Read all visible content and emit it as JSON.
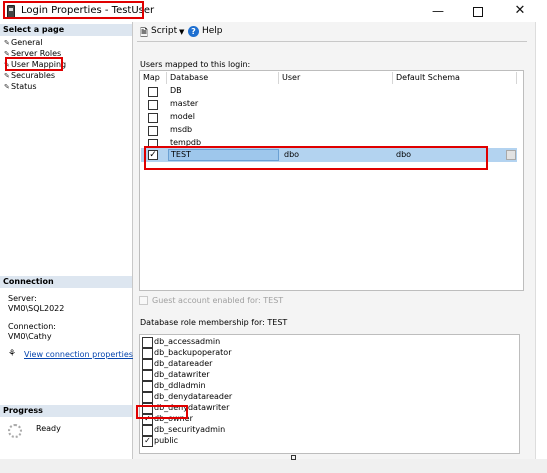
{
  "window": {
    "title": "Login Properties - TestUser"
  },
  "left": {
    "select_page_header": "Select a page",
    "pages": [
      "General",
      "Server Roles",
      "User Mapping",
      "Securables",
      "Status"
    ],
    "connection_header": "Connection",
    "server_label": "Server:",
    "server_value": "VM0\\SQL2022",
    "connection_label": "Connection:",
    "connection_value": "VM0\\Cathy",
    "view_connection_link": "View connection properties",
    "progress_header": "Progress",
    "progress_status": "Ready"
  },
  "toolbar": {
    "script_label": "Script",
    "help_label": "Help"
  },
  "mapping": {
    "section_label": "Users mapped to this login:",
    "columns": [
      "Map",
      "Database",
      "User",
      "Default Schema"
    ],
    "rows": [
      {
        "map": false,
        "database": "DB",
        "user": "",
        "schema": ""
      },
      {
        "map": false,
        "database": "master",
        "user": "",
        "schema": ""
      },
      {
        "map": false,
        "database": "model",
        "user": "",
        "schema": ""
      },
      {
        "map": false,
        "database": "msdb",
        "user": "",
        "schema": ""
      },
      {
        "map": false,
        "database": "tempdb",
        "user": "",
        "schema": ""
      },
      {
        "map": true,
        "database": "TEST",
        "user": "dbo",
        "schema": "dbo"
      }
    ]
  },
  "guest": {
    "label": "Guest account enabled for: TEST",
    "enabled": false
  },
  "roles": {
    "section_label": "Database role membership for: TEST",
    "items": [
      {
        "name": "db_accessadmin",
        "checked": false
      },
      {
        "name": "db_backupoperator",
        "checked": false
      },
      {
        "name": "db_datareader",
        "checked": false
      },
      {
        "name": "db_datawriter",
        "checked": false
      },
      {
        "name": "db_ddladmin",
        "checked": false
      },
      {
        "name": "db_denydatareader",
        "checked": false
      },
      {
        "name": "db_denydatawriter",
        "checked": false
      },
      {
        "name": "db_owner",
        "checked": true
      },
      {
        "name": "db_securityadmin",
        "checked": false
      },
      {
        "name": "public",
        "checked": true
      }
    ]
  },
  "colors": {
    "highlight_box": "#e00000",
    "selected_row": "#b3d3f0",
    "section_header": "#dde6f0",
    "link": "#0645ad"
  },
  "icons": {
    "app": "window-app-icon",
    "script": "script-icon",
    "help": "help-icon",
    "connection": "connection-icon"
  }
}
